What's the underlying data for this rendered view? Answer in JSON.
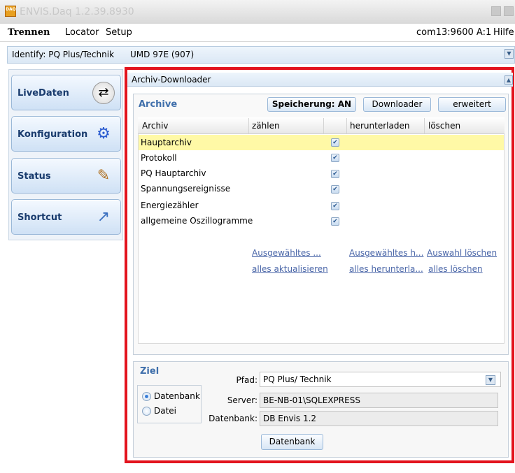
{
  "window": {
    "title": "ENVIS.Daq 1.2.39.8930",
    "app_icon_text": "DAQ"
  },
  "menu": {
    "items": [
      "Trennen",
      "Locator",
      "Setup"
    ],
    "status": "com13:9600 A:1",
    "help": "Hilfe"
  },
  "identify": {
    "label": "Identify: PQ Plus/Technik",
    "device": "UMD 97E (907)"
  },
  "nav": {
    "items": [
      {
        "label": "LiveDaten",
        "icon": "refresh-icon"
      },
      {
        "label": "Konfiguration",
        "icon": "gears-icon"
      },
      {
        "label": "Status",
        "icon": "notepad-pen-icon"
      },
      {
        "label": "Shortcut",
        "icon": "shortcut-icon"
      }
    ]
  },
  "downloader": {
    "title": "Archiv-Downloader",
    "archive_heading": "Archive",
    "buttons": {
      "speicherung": "Speicherung: AN",
      "downloader": "Downloader",
      "erweitert": "erweitert"
    },
    "columns": [
      "Archiv",
      "zählen",
      "herunterladen",
      "löschen"
    ],
    "rows": [
      {
        "name": "Hauptarchiv",
        "checked": true,
        "selected": true
      },
      {
        "name": "Protokoll",
        "checked": true,
        "selected": false
      },
      {
        "name": "PQ Hauptarchiv",
        "checked": true,
        "selected": false
      },
      {
        "name": "Spannungsereignisse",
        "checked": true,
        "selected": false
      },
      {
        "name": "Energiezähler",
        "checked": true,
        "selected": false
      },
      {
        "name": "allgemeine Oszillogramme",
        "checked": true,
        "selected": false
      }
    ],
    "links": {
      "count_selected": "Ausgewähltes ...",
      "count_all": "alles aktualisieren",
      "download_selected": "Ausgewähltes h...",
      "download_all": "alles herunterla...",
      "delete_selected": "Auswahl löschen",
      "delete_all": "alles löschen"
    }
  },
  "ziel": {
    "heading": "Ziel",
    "options": [
      "Datenbank",
      "Datei"
    ],
    "selected_option": "Datenbank",
    "pfad_label": "Pfad:",
    "pfad_value": "PQ Plus/ Technik",
    "server_label": "Server:",
    "server_value": "BE-NB-01\\SQLEXPRESS",
    "datenbank_label": "Datenbank:",
    "datenbank_value": "DB Envis 1.2",
    "datenbank_button": "Datenbank"
  },
  "colors": {
    "highlight_frame": "#e3141e",
    "selected_row": "#fff9a6",
    "link": "#4a66a8",
    "heading": "#3f6fab"
  }
}
